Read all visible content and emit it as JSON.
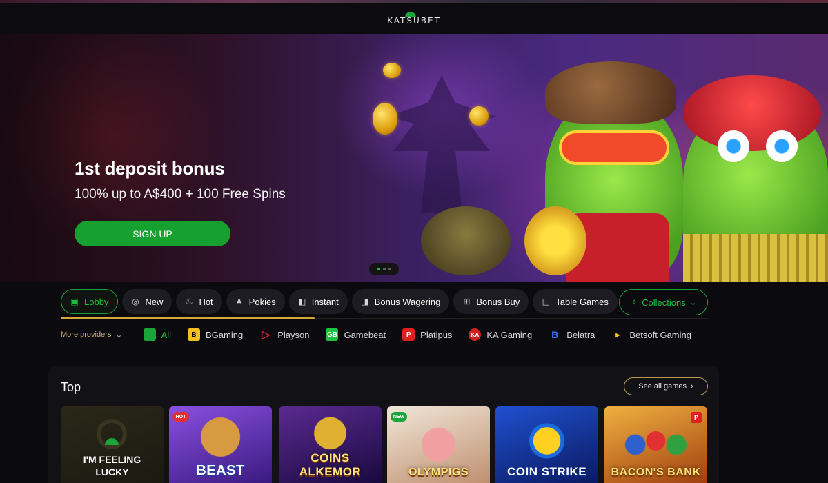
{
  "brand": {
    "logo_text": "KATSUBET",
    "accent": "#1aa53a",
    "gold": "#d4a93a"
  },
  "hero": {
    "title": "1st deposit bonus",
    "subtitle": "100% up to A$400 + 100 Free Spins",
    "cta_label": "SIGN UP",
    "slides": 3,
    "active_slide": 1
  },
  "categories": {
    "tabs": [
      {
        "label": "Lobby",
        "icon": "lobby-icon",
        "active": true
      },
      {
        "label": "New",
        "icon": "new-icon"
      },
      {
        "label": "Hot",
        "icon": "flame-icon"
      },
      {
        "label": "Pokies",
        "icon": "cherries-icon"
      },
      {
        "label": "Instant",
        "icon": "instant-icon"
      },
      {
        "label": "Bonus Wagering",
        "icon": "bonus-wagering-icon"
      },
      {
        "label": "Bonus Buy",
        "icon": "gift-icon"
      },
      {
        "label": "Table Games",
        "icon": "table-games-icon"
      }
    ],
    "collections_label": "Collections"
  },
  "providers": {
    "more_label": "More providers",
    "items": [
      {
        "label": "All",
        "logo": "",
        "color": "#1aa53a",
        "active": true
      },
      {
        "label": "BGaming",
        "logo": "B",
        "color": "#f4c020"
      },
      {
        "label": "Playson",
        "logo": "▷",
        "color": "#e02030"
      },
      {
        "label": "Gamebeat",
        "logo": "GB",
        "color": "#20c040"
      },
      {
        "label": "Platipus",
        "logo": "P",
        "color": "#e02020"
      },
      {
        "label": "KA Gaming",
        "logo": "KA",
        "color": "#d02020"
      },
      {
        "label": "Belatra",
        "logo": "B",
        "color": "#2050d0"
      },
      {
        "label": "Betsoft Gaming",
        "logo": "▸",
        "color": "#f0c020"
      }
    ]
  },
  "top_section": {
    "title": "Top",
    "see_all_label": "See all games",
    "games": [
      {
        "title": "I'M FEELING LUCKY",
        "badge": "",
        "bg": "linear-gradient(160deg,#2a2818,#1a1a12)"
      },
      {
        "title": "BEAST",
        "badge": "HOT",
        "bg": "linear-gradient(160deg,#7a40d0,#3a1a80)"
      },
      {
        "title": "COINS ALKEMOR",
        "badge": "",
        "bg": "linear-gradient(160deg,#4a2080,#1a0a40)"
      },
      {
        "title": "OLYMPIGS",
        "badge": "NEW",
        "bg": "linear-gradient(160deg,#f0e0d0,#c09070)"
      },
      {
        "title": "COIN STRIKE",
        "badge": "",
        "bg": "linear-gradient(160deg,#1a40c0,#0a1a60)"
      },
      {
        "title": "BACON'S BANK",
        "badge": "P",
        "bg": "linear-gradient(160deg,#e0a030,#a04010)"
      }
    ]
  }
}
